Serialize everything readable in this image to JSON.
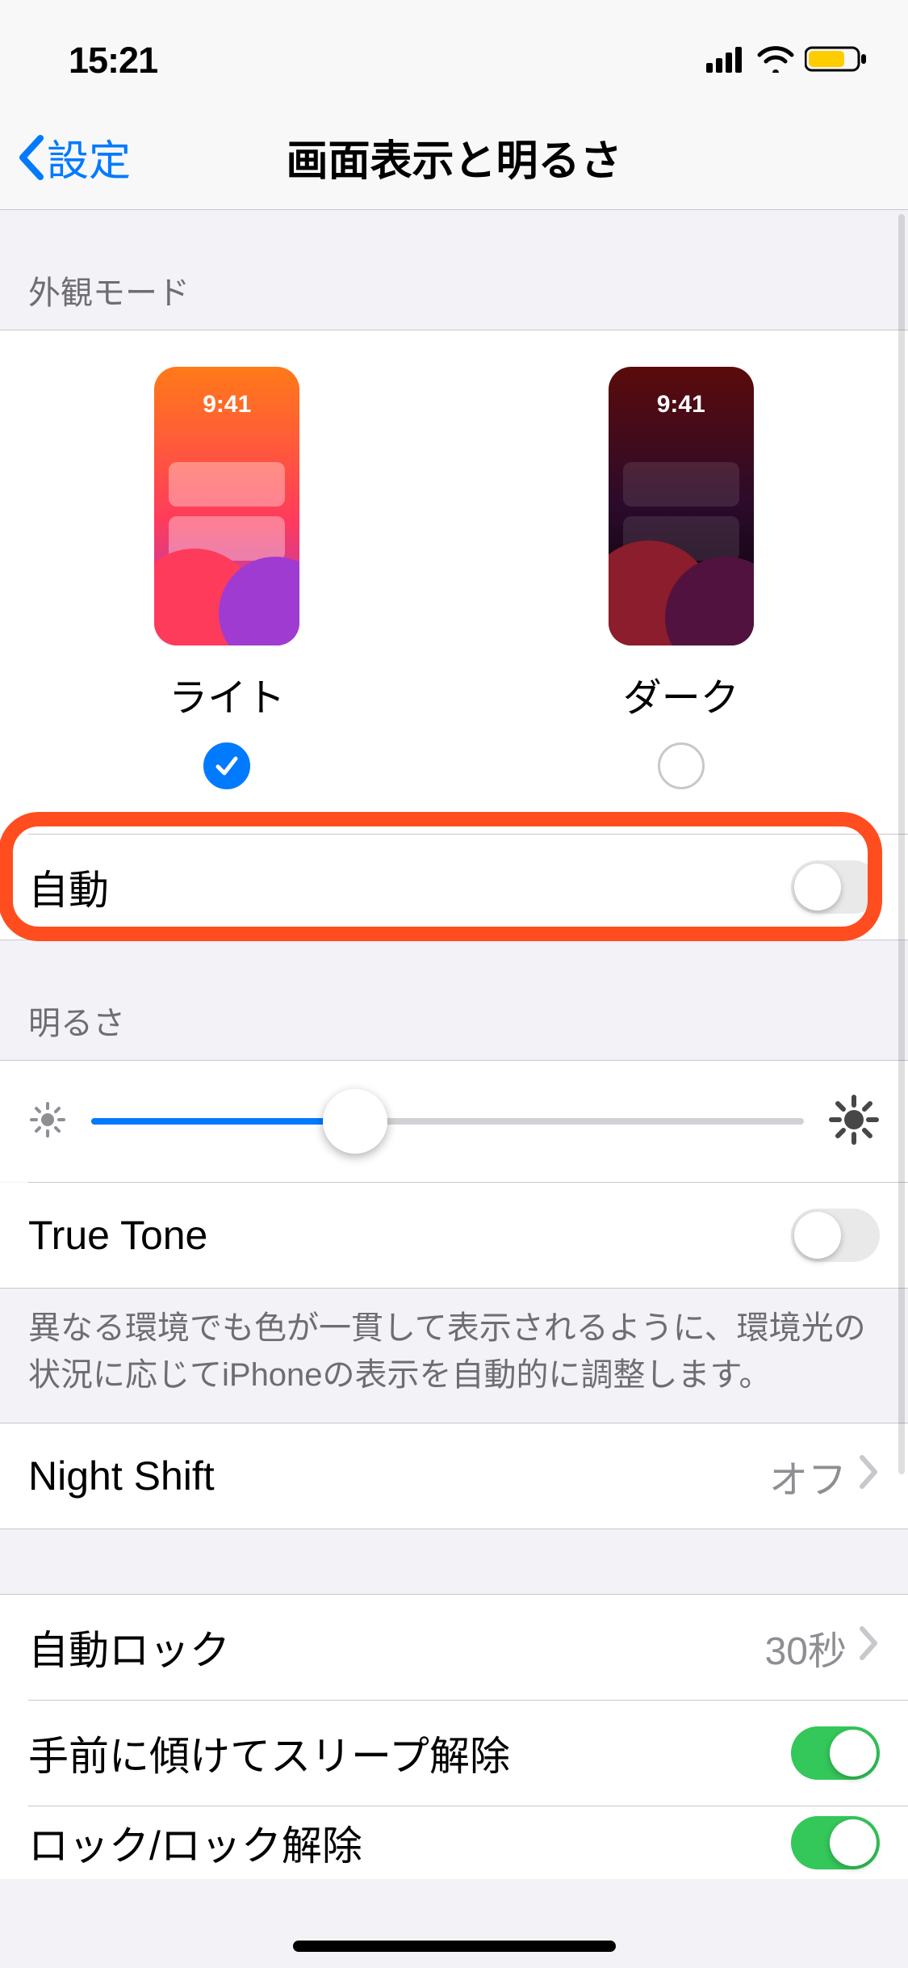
{
  "status": {
    "time": "15:21"
  },
  "nav": {
    "back": "設定",
    "title": "画面表示と明るさ"
  },
  "appearance": {
    "header": "外観モード",
    "preview_time": "9:41",
    "light_label": "ライト",
    "dark_label": "ダーク",
    "selected": "light",
    "automatic_label": "自動",
    "automatic_on": false
  },
  "brightness": {
    "header": "明るさ",
    "value_percent": 37,
    "truetone_label": "True Tone",
    "truetone_on": false,
    "truetone_footer": "異なる環境でも色が一貫して表示されるように、環境光の状況に応じてiPhoneの表示を自動的に調整します。"
  },
  "night_shift": {
    "label": "Night Shift",
    "value": "オフ"
  },
  "autolock": {
    "label": "自動ロック",
    "value": "30秒"
  },
  "raise_to_wake": {
    "label": "手前に傾けてスリープ解除",
    "on": true
  },
  "lock_unlock": {
    "label": "ロック/ロック解除",
    "on": true
  }
}
